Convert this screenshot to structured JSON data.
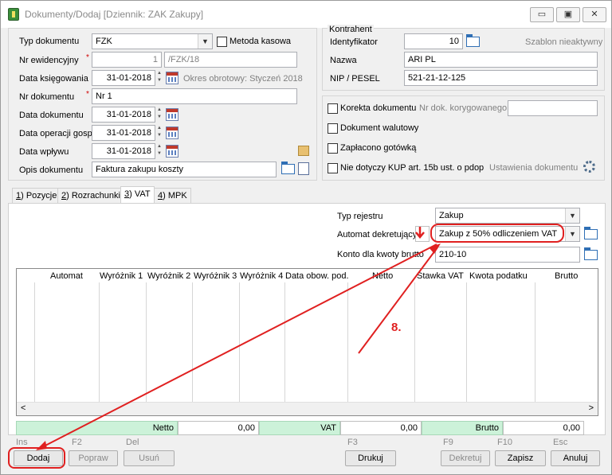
{
  "window": {
    "title": "Dokumenty/Dodaj [Dziennik: ZAK  Zakupy]"
  },
  "left": {
    "typ_label": "Typ dokumentu",
    "typ_value": "FZK",
    "metoda_label": "Metoda kasowa",
    "nr_ewid_label": "Nr ewidencyjny",
    "nr_ewid_value": "1",
    "nr_ewid_suffix": "/FZK/18",
    "data_ksieg_label": "Data księgowania",
    "data_ksieg_value": "31-01-2018",
    "okres_text": "Okres obrotowy: Styczeń 2018",
    "nr_dok_label": "Nr dokumentu",
    "nr_dok_value": "Nr 1",
    "data_dok_label": "Data dokumentu",
    "data_dok_value": "31-01-2018",
    "data_oper_label": "Data operacji gosp.",
    "data_oper_value": "31-01-2018",
    "data_wplywu_label": "Data wpływu",
    "data_wplywu_value": "31-01-2018",
    "opis_label": "Opis dokumentu",
    "opis_value": "Faktura zakupu koszty"
  },
  "right": {
    "kontrahent_label": "Kontrahent",
    "ident_label": "Identyfikator",
    "ident_value": "10",
    "szablon_text": "Szablon nieaktywny",
    "nazwa_label": "Nazwa",
    "nazwa_value": "ARI PL",
    "nip_label": "NIP / PESEL",
    "nip_value": "521-21-12-125",
    "korekta_label": "Korekta dokumentu",
    "nr_dok_kor_label": "Nr dok. korygowanego",
    "walutowy_label": "Dokument walutowy",
    "gotowka_label": "Zapłacono gotówką",
    "kup_label": "Nie dotyczy KUP art. 15b ust. o pdop",
    "ustawienia_text": "Ustawienia dokumentu"
  },
  "tabs": [
    {
      "num": "1",
      "label": ") Pozycje"
    },
    {
      "num": "2",
      "label": ") Rozrachunki"
    },
    {
      "num": "3",
      "label": ") VAT"
    },
    {
      "num": "4",
      "label": ") MPK"
    }
  ],
  "vat": {
    "typ_rej_label": "Typ rejestru",
    "typ_rej_value": "Zakup",
    "automat_label": "Automat dekretujący",
    "automat_value": "Zakup z 50% odliczeniem VAT",
    "konto_label": "Konto dla kwoty brutto",
    "konto_value": "210-10"
  },
  "grid": {
    "columns": [
      "Automat",
      "Wyróżnik 1",
      "Wyróżnik 2",
      "Wyróżnik 3",
      "Wyróżnik 4",
      "Data obow. pod.",
      "Netto",
      "Stawka VAT",
      "Kwota podatku",
      "Brutto"
    ]
  },
  "sums": {
    "netto_label": "Netto",
    "netto_value": "0,00",
    "vat_label": "VAT",
    "vat_value": "0,00",
    "brutto_label": "Brutto",
    "brutto_value": "0,00"
  },
  "buttons": {
    "dodaj_key": "Ins",
    "dodaj": "Dodaj",
    "popraw_key": "F2",
    "popraw": "Popraw",
    "usun_key": "Del",
    "usun": "Usuń",
    "drukuj_key": "F3",
    "drukuj": "Drukuj",
    "dekretuj_key": "F9",
    "dekretuj": "Dekretuj",
    "zapisz_key": "F10",
    "zapisz": "Zapisz",
    "anuluj_key": "Esc",
    "anuluj": "Anuluj"
  },
  "annotation": {
    "step": "8."
  },
  "colors": {
    "annotation_red": "#e02020",
    "sum_green": "#ccf2d9"
  }
}
